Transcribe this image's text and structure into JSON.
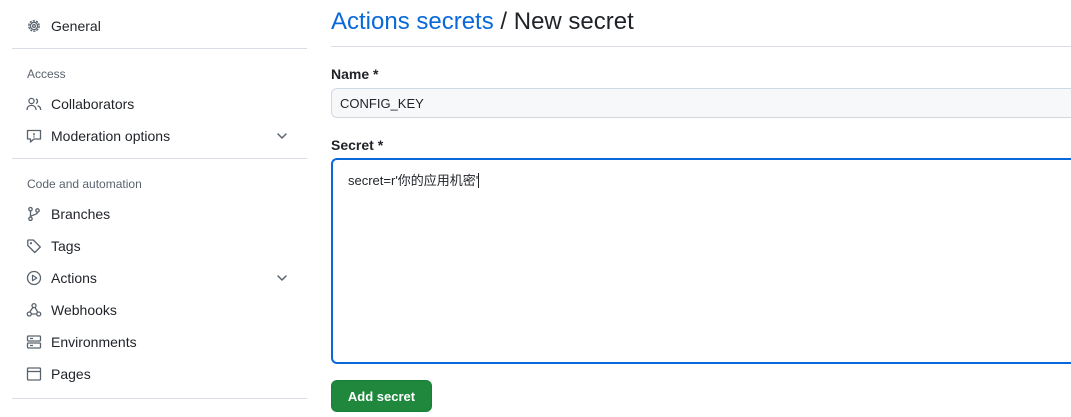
{
  "sidebar": {
    "general": "General",
    "access_title": "Access",
    "collaborators": "Collaborators",
    "moderation": "Moderation options",
    "code_title": "Code and automation",
    "branches": "Branches",
    "tags": "Tags",
    "actions": "Actions",
    "webhooks": "Webhooks",
    "environments": "Environments",
    "pages": "Pages"
  },
  "header": {
    "breadcrumb": "Actions secrets",
    "separator": " / ",
    "title": "New secret"
  },
  "form": {
    "name_label": "Name *",
    "name_value": "CONFIG_KEY",
    "secret_label": "Secret *",
    "secret_value": "secret=r'你的应用机密'",
    "submit_label": "Add secret"
  },
  "colors": {
    "accent": "#0969da",
    "button": "#1f883d"
  }
}
